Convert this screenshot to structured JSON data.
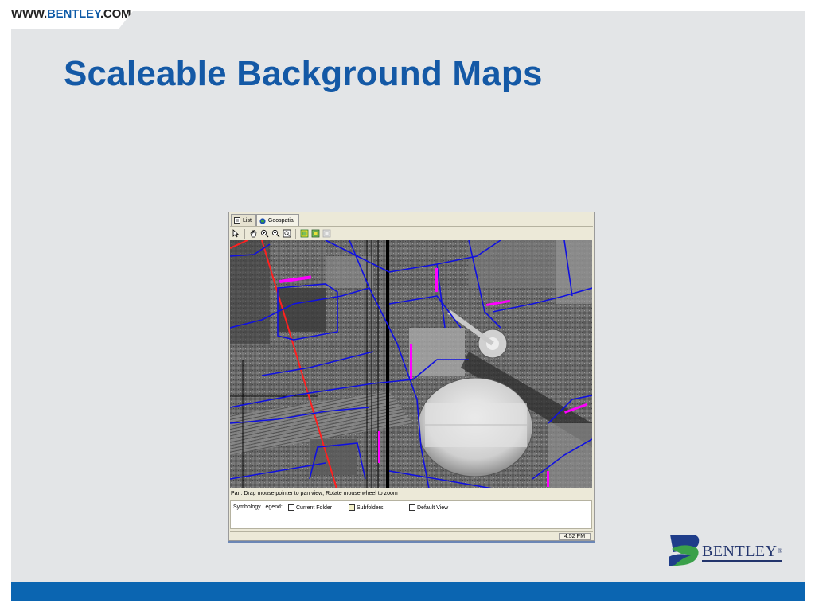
{
  "slide": {
    "url_prefix": "WWW.",
    "url_brand": "BENTLEY",
    "url_suffix": ".COM",
    "title": "Scaleable Background Maps"
  },
  "app": {
    "tabs": [
      {
        "label": "List",
        "icon": "list-icon"
      },
      {
        "label": "Geospatial",
        "icon": "globe-icon"
      }
    ],
    "toolbar_tools": [
      "select-arrow-icon",
      "pan-hand-icon",
      "zoom-in-icon",
      "zoom-out-icon",
      "zoom-extents-icon",
      "layer-icon",
      "layer-props-icon",
      "layer-disabled-icon"
    ],
    "status_text": "Pan: Drag mouse pointer to pan view; Rotate mouse wheel to zoom",
    "legend": {
      "label": "Symbology Legend:",
      "items": [
        {
          "label": "Current Folder",
          "color": "#ffffff"
        },
        {
          "label": "Subfolders",
          "color": "#f2f0c8"
        },
        {
          "label": "Default View",
          "color": "#ffffff"
        }
      ]
    },
    "clock": "4:52 PM"
  },
  "logo": {
    "text": "BENTLEY",
    "reg": "®"
  },
  "colors": {
    "title": "#1459a6",
    "footer": "#0b65b1",
    "map_roads": "#1010e0",
    "map_rail": "#ff2020",
    "map_marks": "#ff00ff"
  }
}
